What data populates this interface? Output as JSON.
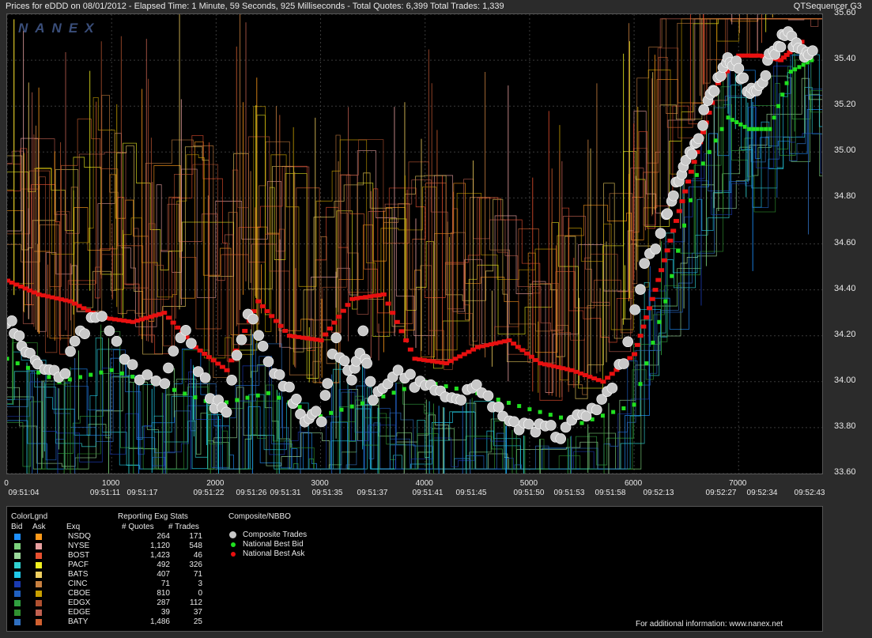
{
  "header": {
    "left": "Prices for  eDDD  on  08/01/2012  -  Elapsed Time: 1 Minute, 59 Seconds, 925 Milliseconds  -  Total Quotes: 6,399  Total Trades: 1,339",
    "right": "QTSequencer G3"
  },
  "logo": "NANEX",
  "chart_data": {
    "type": "scatter",
    "ylim": [
      33.6,
      35.6
    ],
    "yticks": [
      "35.60",
      "35.40",
      "35.20",
      "35.00",
      "34.80",
      "34.60",
      "34.40",
      "34.20",
      "34.00",
      "33.80",
      "33.60"
    ],
    "xlim": [
      0,
      7800
    ],
    "xticks": [
      "0",
      "1000",
      "2000",
      "3000",
      "4000",
      "5000",
      "6000",
      "7000"
    ],
    "time_labels": [
      "09:51:04",
      "09:51:11",
      "09:51:17",
      "09:51:22",
      "09:51:26",
      "09:51:31",
      "09:51:35",
      "09:51:37",
      "09:51:41",
      "09:51:45",
      "09:51:50",
      "09:51:53",
      "09:51:58",
      "09:52:13",
      "09:52:27",
      "09:52:34",
      "09:52:43"
    ],
    "series": [
      {
        "name": "Composite Trades",
        "color": "#c8c8c8",
        "x": [
          0,
          150,
          300,
          500,
          700,
          900,
          1200,
          1500,
          1700,
          1950,
          2100,
          2300,
          2500,
          2700,
          2850,
          3000,
          3150,
          3300,
          3400,
          3500,
          3700,
          3900,
          4100,
          4300,
          4500,
          4700,
          4900,
          5100,
          5300,
          5500,
          5700,
          5900,
          6100,
          6300,
          6400,
          6500,
          6600,
          6700,
          6800,
          6900,
          7000,
          7100,
          7200,
          7300,
          7400,
          7500,
          7600,
          7700
        ],
        "y": [
          34.28,
          34.16,
          34.06,
          34.02,
          34.2,
          34.3,
          34.05,
          34.0,
          34.22,
          33.92,
          33.88,
          34.32,
          34.06,
          33.95,
          33.85,
          33.84,
          34.18,
          33.98,
          34.2,
          33.9,
          34.05,
          34.0,
          33.95,
          33.92,
          34.0,
          33.88,
          33.82,
          33.8,
          33.78,
          33.85,
          33.9,
          34.1,
          34.5,
          34.7,
          34.88,
          34.95,
          35.05,
          35.2,
          35.3,
          35.42,
          35.38,
          35.25,
          35.3,
          35.42,
          35.48,
          35.5,
          35.45,
          35.42
        ]
      },
      {
        "name": "National Best Bid",
        "color": "#20e020",
        "x": [
          0,
          500,
          1000,
          1500,
          2000,
          2500,
          3000,
          3500,
          4000,
          4500,
          5000,
          5500,
          6000,
          6300,
          6600,
          6900,
          7100,
          7300,
          7500,
          7700
        ],
        "y": [
          34.1,
          34.0,
          34.05,
          33.98,
          33.9,
          33.95,
          33.85,
          33.92,
          34.0,
          33.95,
          33.88,
          33.82,
          33.9,
          34.35,
          34.9,
          35.15,
          35.1,
          35.1,
          35.35,
          35.4
        ]
      },
      {
        "name": "National Best Ask",
        "color": "#e81010",
        "x": [
          0,
          300,
          600,
          900,
          1200,
          1500,
          1800,
          2100,
          2400,
          2700,
          3000,
          3300,
          3600,
          3900,
          4200,
          4500,
          4800,
          5100,
          5400,
          5700,
          6000,
          6200,
          6400,
          6600,
          6800,
          7000,
          7200,
          7400,
          7600
        ],
        "y": [
          34.44,
          34.38,
          34.35,
          34.28,
          34.26,
          34.3,
          34.15,
          34.05,
          34.35,
          34.2,
          34.18,
          34.36,
          34.38,
          34.1,
          34.08,
          34.15,
          34.18,
          34.08,
          34.05,
          34.0,
          34.12,
          34.4,
          34.7,
          35.0,
          35.3,
          35.42,
          35.42,
          35.4,
          35.48
        ]
      }
    ]
  },
  "legend": {
    "colorlgnd": "ColorLgnd",
    "bid": "Bid",
    "ask": "Ask",
    "exq": "Exq",
    "reporting": "Reporting Exg Stats",
    "quotes_hdr": "# Quotes",
    "trades_hdr": "# Trades",
    "composite": "Composite/NBBO",
    "rows": [
      {
        "exq": "NSDQ",
        "quotes": "264",
        "trades": "171",
        "bid_color": "#1e90ff",
        "ask_color": "#ff9a1a"
      },
      {
        "exq": "NYSE",
        "quotes": "1,120",
        "trades": "548",
        "bid_color": "#7cd27c",
        "ask_color": "#e8a0a0"
      },
      {
        "exq": "BOST",
        "quotes": "1,423",
        "trades": "46",
        "bid_color": "#9ad89a",
        "ask_color": "#e85030"
      },
      {
        "exq": "PACF",
        "quotes": "492",
        "trades": "326",
        "bid_color": "#30d0d0",
        "ask_color": "#f0f020"
      },
      {
        "exq": "BATS",
        "quotes": "407",
        "trades": "71",
        "bid_color": "#20c8e8",
        "ask_color": "#f0d060"
      },
      {
        "exq": "CINC",
        "quotes": "71",
        "trades": "3",
        "bid_color": "#1a3ab0",
        "ask_color": "#c88040"
      },
      {
        "exq": "CBOE",
        "quotes": "810",
        "trades": "0",
        "bid_color": "#2060c0",
        "ask_color": "#c8a000"
      },
      {
        "exq": "EDGX",
        "quotes": "287",
        "trades": "112",
        "bid_color": "#30a040",
        "ask_color": "#b05030"
      },
      {
        "exq": "EDGE",
        "quotes": "39",
        "trades": "37",
        "bid_color": "#309030",
        "ask_color": "#c06050"
      },
      {
        "exq": "BATY",
        "quotes": "1,486",
        "trades": "25",
        "bid_color": "#3070c0",
        "ask_color": "#d06030"
      }
    ],
    "nbbo": [
      {
        "label": "Composite Trades",
        "color": "#c8c8c8"
      },
      {
        "label": "National Best Bid",
        "color": "#20e020"
      },
      {
        "label": "National Best Ask",
        "color": "#e81010"
      }
    ],
    "footer": "For additional information: www.nanex.net"
  }
}
